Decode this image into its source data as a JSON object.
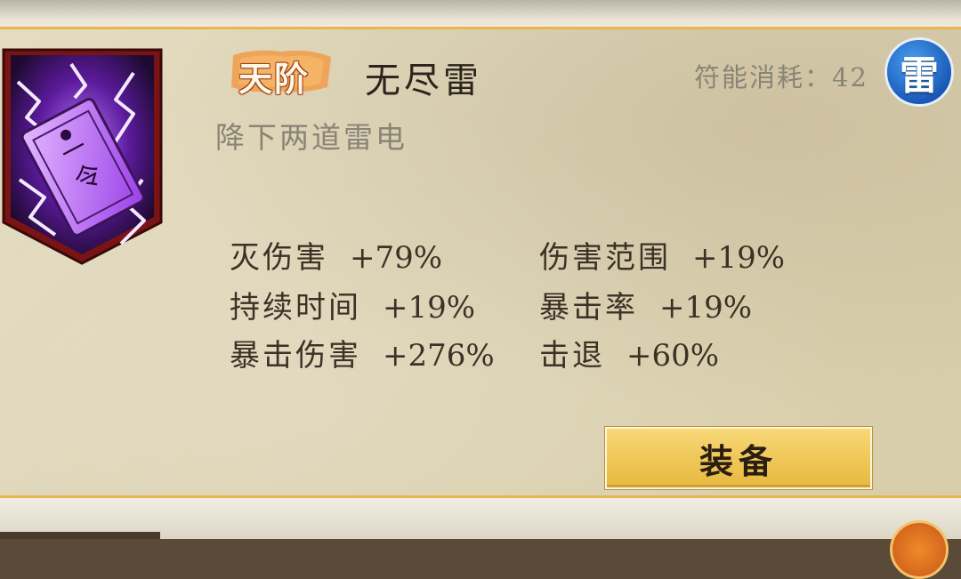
{
  "skill": {
    "tier": "天阶",
    "name": "无尽雷",
    "description": "降下两道雷电",
    "cost_label": "符能消耗：",
    "cost_value": "42",
    "element": "雷"
  },
  "stats": [
    {
      "name": "灭伤害",
      "value": "+79%"
    },
    {
      "name": "伤害范围",
      "value": "+19%"
    },
    {
      "name": "持续时间",
      "value": "+19%"
    },
    {
      "name": "暴击率",
      "value": "+19%"
    },
    {
      "name": "暴击伤害",
      "value": "+276%"
    },
    {
      "name": "击退",
      "value": "+60%"
    }
  ],
  "actions": {
    "equip_label": "装备"
  },
  "colors": {
    "card_bg": "#ddd3b4",
    "card_border": "#e9b64d",
    "button": "#f0c85a",
    "element_badge": "#1a5ab8",
    "banner": "#8a1e1e",
    "talisman": "#b05af0"
  },
  "icons": {
    "banner": "thunder-talisman-icon",
    "element": "thunder-element-icon"
  }
}
